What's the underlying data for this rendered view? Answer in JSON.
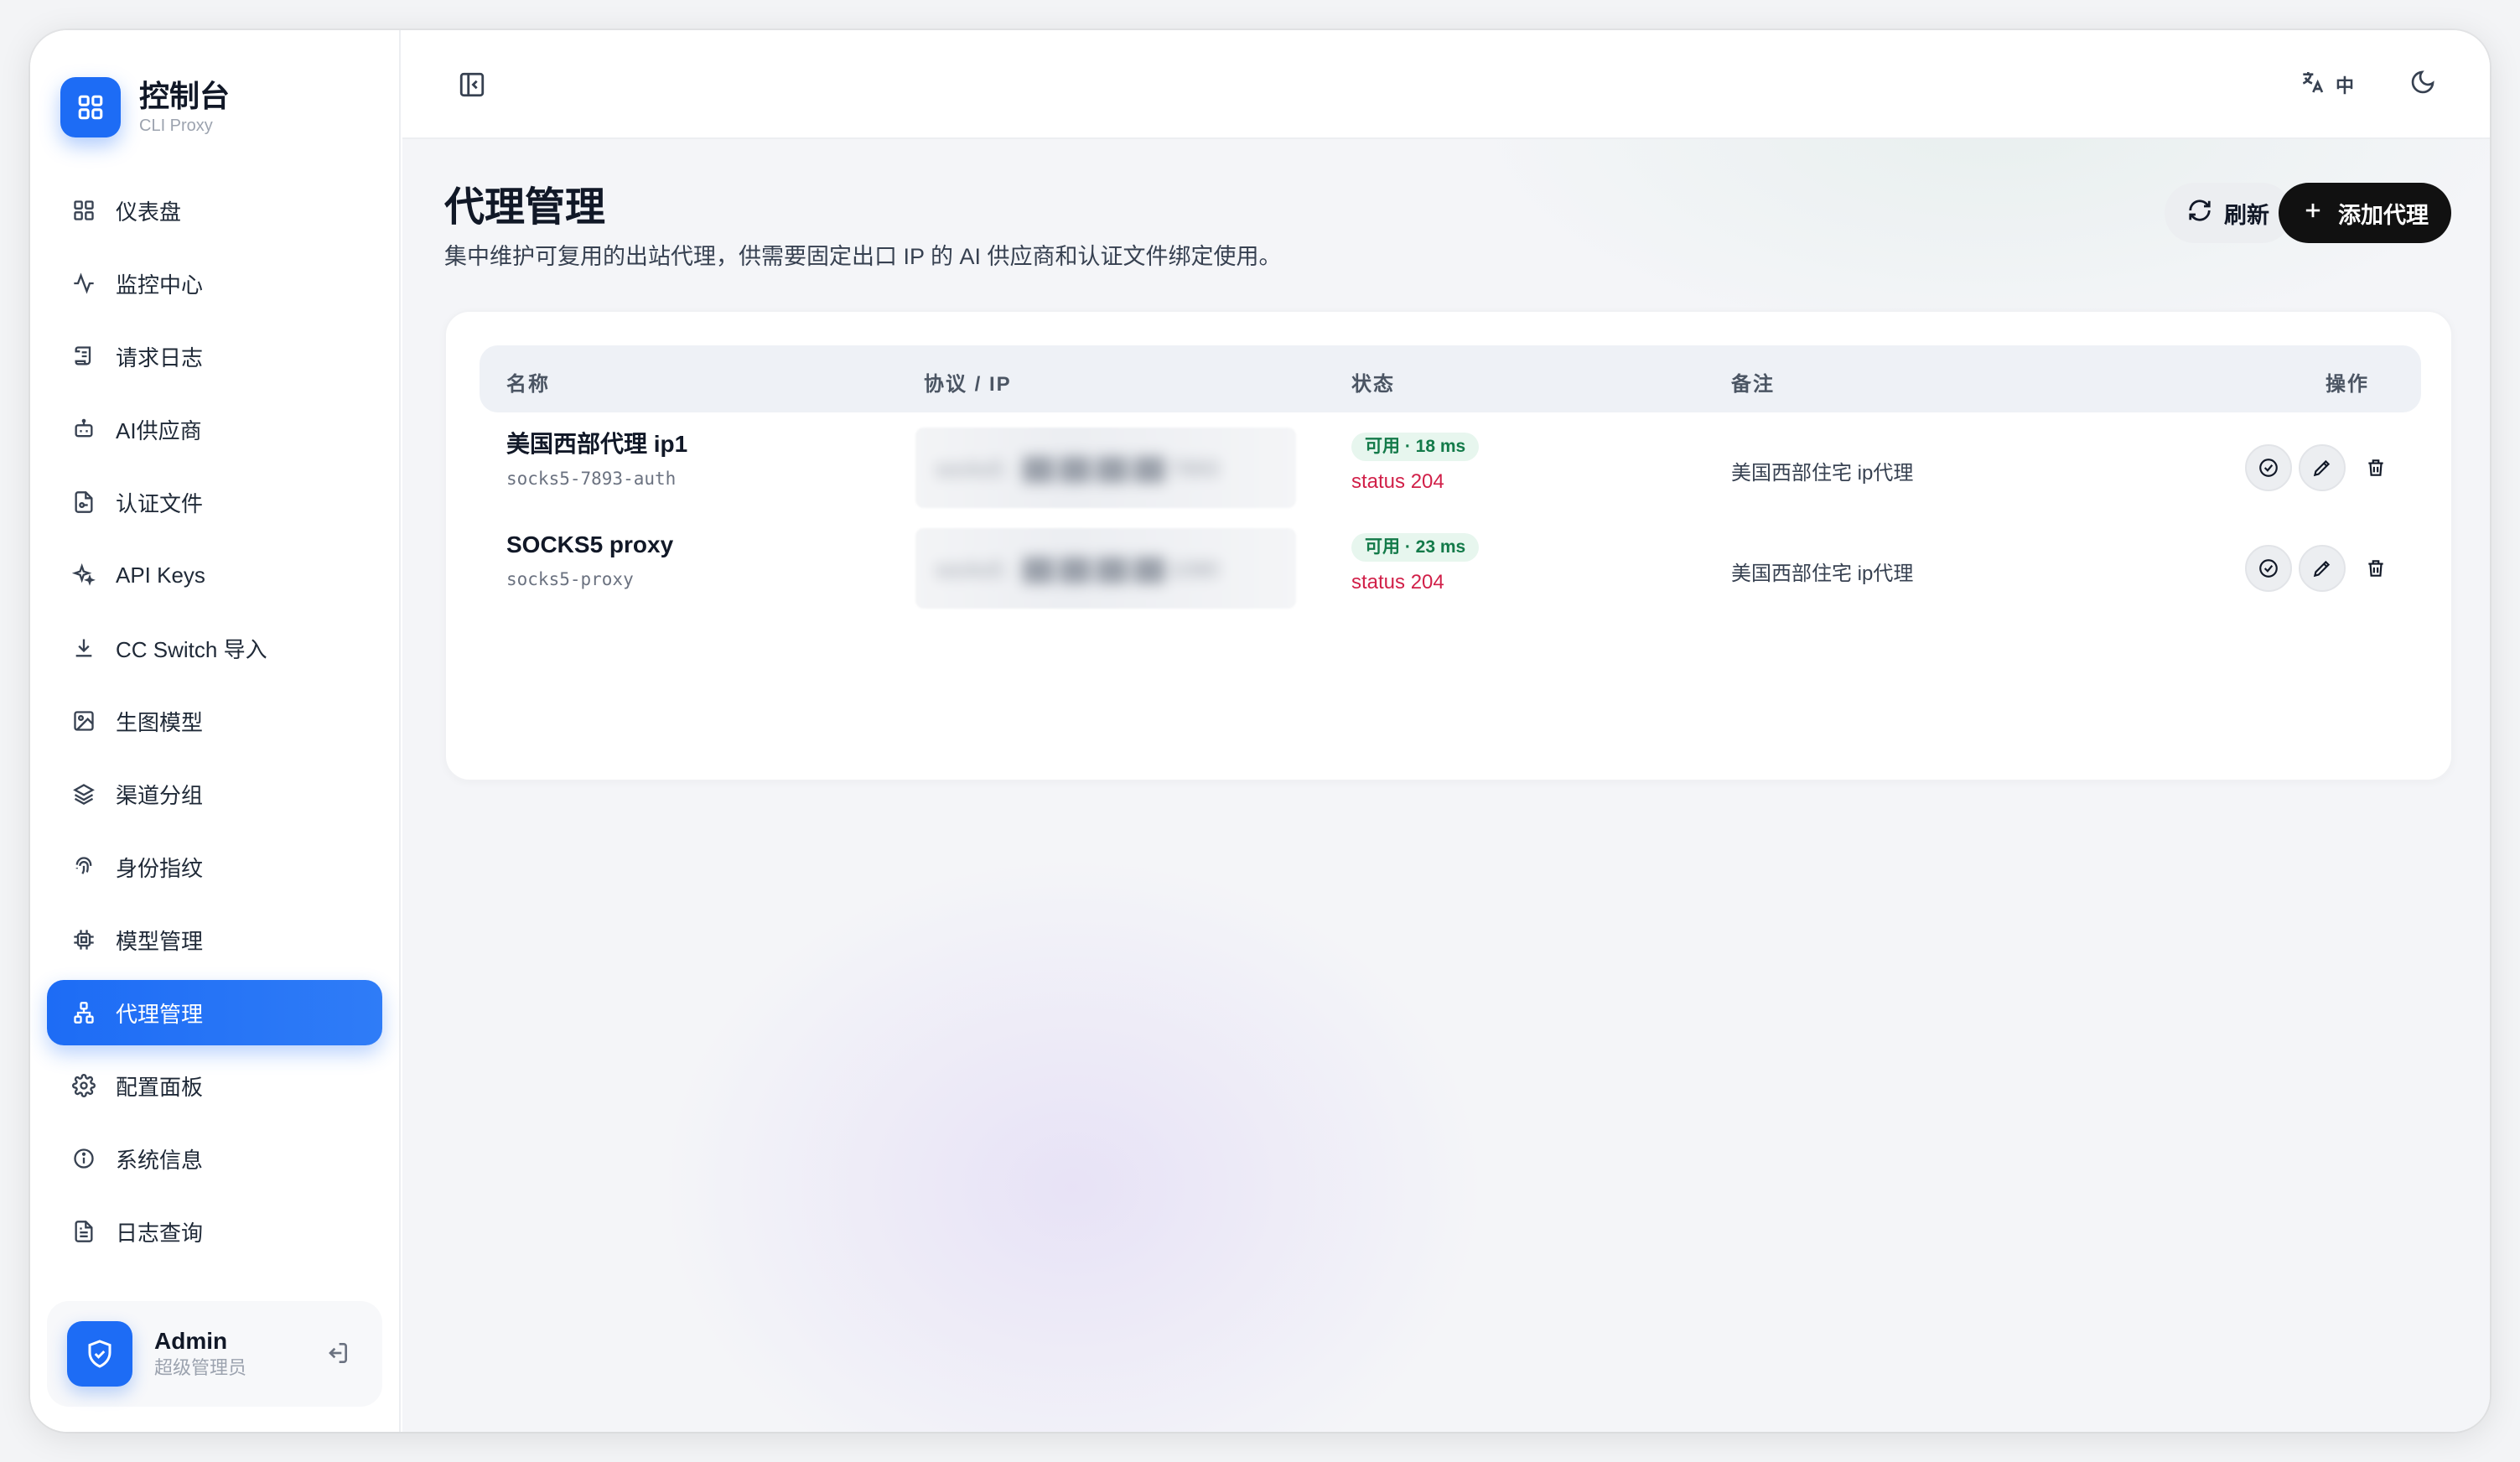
{
  "brand": {
    "title": "控制台",
    "subtitle": "CLI Proxy"
  },
  "sidebar": {
    "items": [
      {
        "label": "仪表盘",
        "icon": "dashboard-grid-icon"
      },
      {
        "label": "监控中心",
        "icon": "activity-pulse-icon"
      },
      {
        "label": "请求日志",
        "icon": "scroll-log-icon"
      },
      {
        "label": "AI供应商",
        "icon": "bot-icon"
      },
      {
        "label": "认证文件",
        "icon": "file-key-icon"
      },
      {
        "label": "API Keys",
        "icon": "sparkles-icon"
      },
      {
        "label": "CC Switch 导入",
        "icon": "download-icon"
      },
      {
        "label": "生图模型",
        "icon": "image-icon"
      },
      {
        "label": "渠道分组",
        "icon": "layers-icon"
      },
      {
        "label": "身份指纹",
        "icon": "fingerprint-icon"
      },
      {
        "label": "模型管理",
        "icon": "cpu-chip-icon"
      },
      {
        "label": "代理管理",
        "icon": "network-icon",
        "active": true
      },
      {
        "label": "配置面板",
        "icon": "gear-icon"
      },
      {
        "label": "系统信息",
        "icon": "info-icon"
      },
      {
        "label": "日志查询",
        "icon": "file-text-icon"
      }
    ]
  },
  "user": {
    "name": "Admin",
    "role": "超级管理员"
  },
  "topbar": {
    "lang_label": "中"
  },
  "page": {
    "title": "代理管理",
    "description": "集中维护可复用的出站代理，供需要固定出口 IP 的 AI 供应商和认证文件绑定使用。",
    "refresh_label": "刷新",
    "add_label": "添加代理"
  },
  "table": {
    "headers": {
      "name": "名称",
      "protocol_ip": "协议 / IP",
      "status": "状态",
      "note": "备注",
      "actions": "操作"
    },
    "rows": [
      {
        "name": "美国西部代理 ip1",
        "id": "socks5-7893-auth",
        "ip": "socks5 · ██.██.██.██:7893",
        "badge": "可用 · 18 ms",
        "status": "status 204",
        "note": "美国西部住宅 ip代理"
      },
      {
        "name": "SOCKS5 proxy",
        "id": "socks5-proxy",
        "ip": "socks5 · ██.██.██.██:1080",
        "badge": "可用 · 23 ms",
        "status": "status 204",
        "note": "美国西部住宅 ip代理"
      }
    ]
  },
  "colors": {
    "accent": "#1d6cf5",
    "success_bg": "#e7f6ee",
    "success_text": "#137a49",
    "status_text": "#d11f48"
  }
}
